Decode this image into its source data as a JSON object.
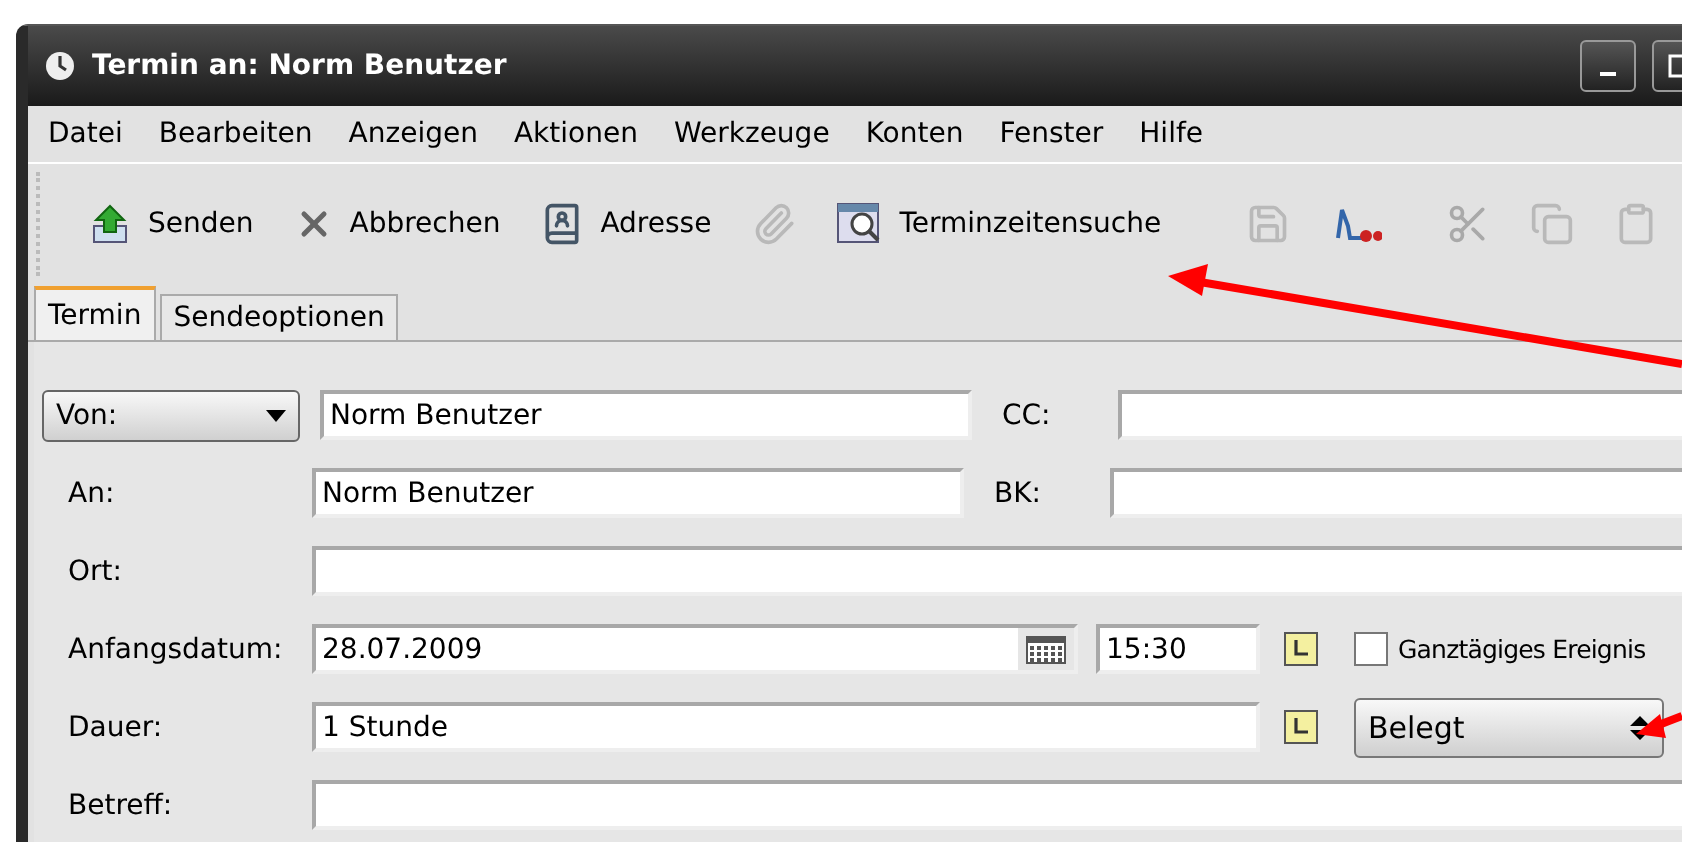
{
  "window": {
    "title": "Termin an: Norm Benutzer"
  },
  "menu": [
    "Datei",
    "Bearbeiten",
    "Anzeigen",
    "Aktionen",
    "Werkzeuge",
    "Konten",
    "Fenster",
    "Hilfe"
  ],
  "toolbar": [
    {
      "kind": "send",
      "label": "Senden",
      "disabled": false
    },
    {
      "kind": "cancel",
      "label": "Abbrechen",
      "disabled": false
    },
    {
      "kind": "address",
      "label": "Adresse",
      "disabled": false
    },
    {
      "kind": "attach",
      "disabled": true
    },
    {
      "kind": "search",
      "label": "Terminzeitensuche",
      "disabled": false
    },
    {
      "kind": "save",
      "disabled": true
    },
    {
      "kind": "sign",
      "disabled": false
    },
    {
      "kind": "cut",
      "disabled": true
    },
    {
      "kind": "copy",
      "disabled": true
    },
    {
      "kind": "paste",
      "disabled": true
    }
  ],
  "tabs": [
    {
      "label": "Termin",
      "selected": true
    },
    {
      "label": "Sendeoptionen",
      "selected": false
    }
  ],
  "form": {
    "from": {
      "selector": "Von:",
      "value": "Norm Benutzer"
    },
    "cc": {
      "label": "CC:"
    },
    "to": {
      "label": "An:",
      "value": "Norm Benutzer"
    },
    "bcc": {
      "label": "BK:"
    },
    "location": {
      "label": "Ort:"
    },
    "start": {
      "label": "Anfangsdatum:",
      "date": "28.07.2009",
      "time": "15:30"
    },
    "all_day": {
      "label": "Ganztägiges Ereignis",
      "checked": false
    },
    "duration": {
      "label": "Dauer:",
      "value": "1 Stunde"
    },
    "show_as": {
      "value": "Belegt"
    },
    "subject": {
      "label": "Betreff:"
    }
  }
}
